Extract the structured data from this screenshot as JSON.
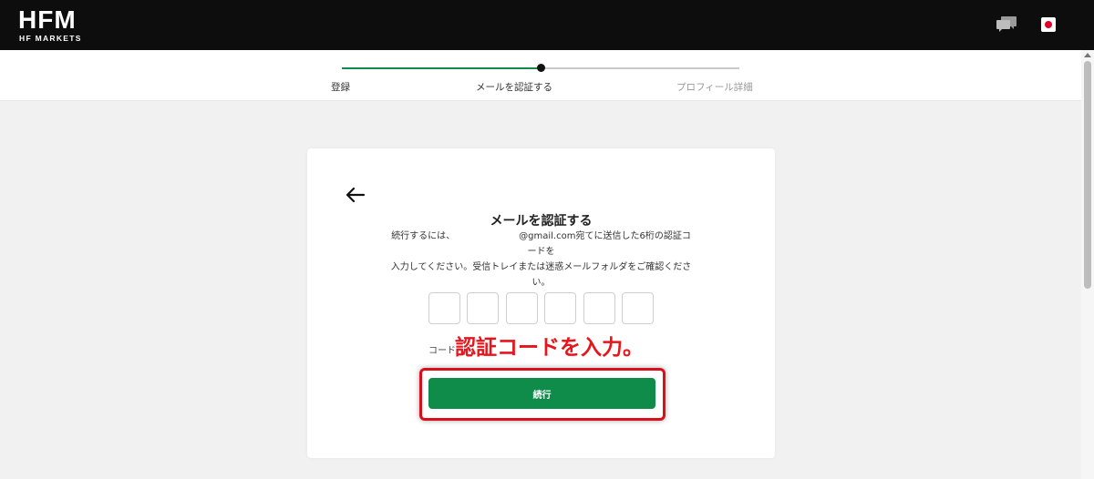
{
  "header": {
    "logo_text": "HFM",
    "logo_subtext": "HF MARKETS",
    "chat_icon": "chat-bubbles-icon",
    "language_flag_icon": "japan-flag-icon"
  },
  "stepper": {
    "steps": [
      {
        "label": "登録",
        "state": "done"
      },
      {
        "label": "メールを認証する",
        "state": "current"
      },
      {
        "label": "プロフィール詳細",
        "state": "todo"
      }
    ],
    "colors": {
      "done": "#0f8c4a",
      "todo": "#c9c9c9",
      "current_dot": "#111111"
    }
  },
  "card": {
    "back_icon": "arrow-left-icon",
    "title": "メールを認証する",
    "desc_pre": "続行するには、",
    "desc_email": "@gmail.com宛てに送信した6桁の認証コードを",
    "desc_rest": "入力してください。受信トレイまたは迷惑メールフォルダをご確認ください。",
    "code_values": [
      "",
      "",
      "",
      "",
      "",
      ""
    ],
    "code_hint": "コード",
    "callout": "認証コードを入力。",
    "continue_label": "続行",
    "accent_color": "#0f8c4a",
    "callout_color": "#e8141b"
  }
}
